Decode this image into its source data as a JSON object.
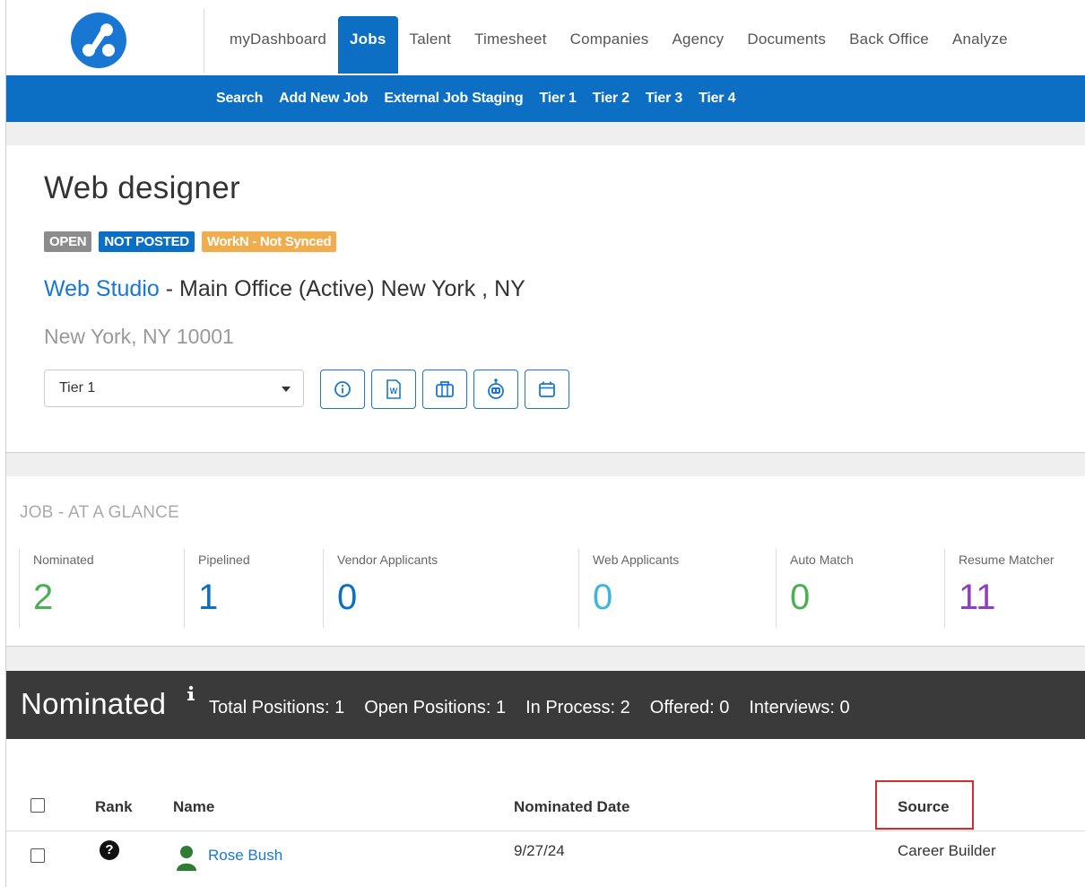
{
  "nav": {
    "tabs": [
      {
        "label": "myDashboard",
        "active": false
      },
      {
        "label": "Jobs",
        "active": true
      },
      {
        "label": "Talent",
        "active": false
      },
      {
        "label": "Timesheet",
        "active": false
      },
      {
        "label": "Companies",
        "active": false
      },
      {
        "label": "Agency",
        "active": false
      },
      {
        "label": "Documents",
        "active": false
      },
      {
        "label": "Back Office",
        "active": false
      },
      {
        "label": "Analyze",
        "active": false
      }
    ],
    "subitems": [
      "Search",
      "Add New Job",
      "External Job Staging",
      "Tier 1",
      "Tier 2",
      "Tier 3",
      "Tier 4"
    ]
  },
  "job": {
    "title": "Web designer",
    "badges": [
      {
        "label": "OPEN",
        "color": "#8c8c8c"
      },
      {
        "label": "NOT POSTED",
        "color": "#0c6fc4"
      },
      {
        "label": "WorkN - Not Synced",
        "color": "#f0ad4e"
      }
    ],
    "company": "Web Studio",
    "office": " - Main Office (Active) New York , NY",
    "address": "New York, NY 10001",
    "tier_select": "Tier 1"
  },
  "glance": {
    "title": "JOB - AT A GLANCE",
    "stats": [
      {
        "label": "Nominated",
        "value": "2",
        "color": "#4caf50"
      },
      {
        "label": "Pipelined",
        "value": "1",
        "color": "#0c6fc4"
      },
      {
        "label": "Vendor Applicants",
        "value": "0",
        "color": "#0c6fc4"
      },
      {
        "label": "Web Applicants",
        "value": "0",
        "color": "#3fb4e0"
      },
      {
        "label": "Auto Match",
        "value": "0",
        "color": "#4caf50"
      },
      {
        "label": "Resume Matcher",
        "value": "11",
        "color": "#8e3fc0"
      }
    ]
  },
  "nominated": {
    "heading": "Nominated",
    "info_icon": "info-icon",
    "total_positions": "Total Positions: 1",
    "open_positions": "Open Positions: 1",
    "in_process": "In Process: 2",
    "offered": "Offered: 0",
    "interviews": "Interviews: 0",
    "columns": {
      "rank": "Rank",
      "name": "Name",
      "nominated_date": "Nominated Date",
      "source": "Source"
    },
    "rows": [
      {
        "rank_icon": "?",
        "name": "Rose Bush",
        "nominated_date": "9/27/24",
        "source": "Career Builder"
      }
    ]
  }
}
